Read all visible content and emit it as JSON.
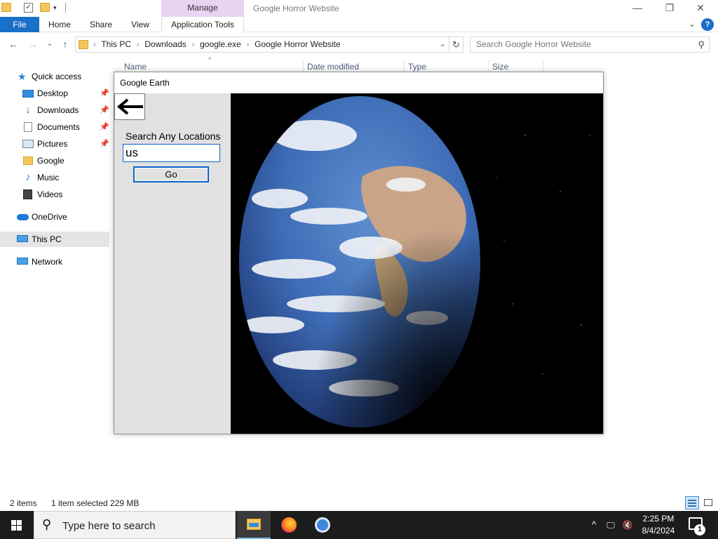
{
  "window": {
    "title": "Google Horror Website",
    "context_tab": "Manage",
    "controls": {
      "minimize": "—",
      "maximize": "❐",
      "close": "✕"
    }
  },
  "ribbon": {
    "tabs": [
      "File",
      "Home",
      "Share",
      "View",
      "Application Tools"
    ],
    "help": "?"
  },
  "address": {
    "crumbs": [
      "This PC",
      "Downloads",
      "google.exe",
      "Google Horror Website"
    ],
    "search_placeholder": "Search Google Horror Website"
  },
  "nav": {
    "items": [
      {
        "label": "Quick access",
        "pinned": false
      },
      {
        "label": "Desktop",
        "pinned": true
      },
      {
        "label": "Downloads",
        "pinned": true
      },
      {
        "label": "Documents",
        "pinned": true
      },
      {
        "label": "Pictures",
        "pinned": true
      },
      {
        "label": "Google",
        "pinned": false
      },
      {
        "label": "Music",
        "pinned": false
      },
      {
        "label": "Videos",
        "pinned": false
      },
      {
        "label": "OneDrive",
        "pinned": false
      },
      {
        "label": "This PC",
        "pinned": false,
        "selected": true
      },
      {
        "label": "Network",
        "pinned": false
      }
    ]
  },
  "columns": [
    "Name",
    "Date modified",
    "Type",
    "Size"
  ],
  "app": {
    "title": "Google Earth",
    "search_label": "Search Any Locations",
    "search_value": "us",
    "go_label": "Go"
  },
  "status": {
    "item_count": "2 items",
    "selected": "1 item selected",
    "size": "229 MB"
  },
  "taskbar": {
    "search_placeholder": "Type here to search",
    "time": "2:25 PM",
    "date": "8/4/2024",
    "notification_count": "1"
  },
  "colors": {
    "accent": "#1a6fc9",
    "context_tab": "#e8d3f1",
    "taskbar": "#1c1c1c",
    "app_panel": "#e1e1e1"
  }
}
